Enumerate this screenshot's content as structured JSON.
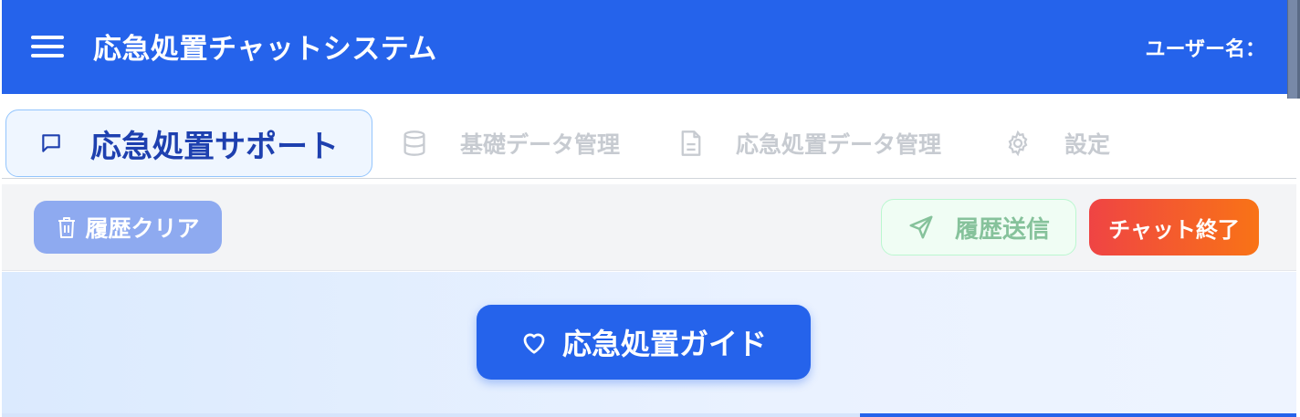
{
  "header": {
    "title": "応急処置チャットシステム",
    "user_label": "ユーザー名：",
    "menu_icon": "hamburger-menu-icon",
    "background": "#2563eb"
  },
  "tabs": [
    {
      "label": "応急処置サポート",
      "icon": "chat-bubble-icon",
      "active": true
    },
    {
      "label": "基礎データ管理",
      "icon": "database-icon",
      "active": false
    },
    {
      "label": "応急処置データ管理",
      "icon": "document-icon",
      "active": false
    },
    {
      "label": "設定",
      "icon": "gear-icon",
      "active": false
    }
  ],
  "toolbar": {
    "clear_label": "履歴クリア",
    "clear_icon": "trash-icon",
    "send_label": "履歴送信",
    "send_icon": "send-icon",
    "end_label": "チャット終了"
  },
  "main": {
    "guide_label": "応急処置ガイド",
    "guide_icon": "heart-icon"
  },
  "colors": {
    "primary": "#2563eb",
    "end_gradient_start": "#ef4444",
    "end_gradient_end": "#f97316",
    "send_border": "#bbf7d0"
  }
}
